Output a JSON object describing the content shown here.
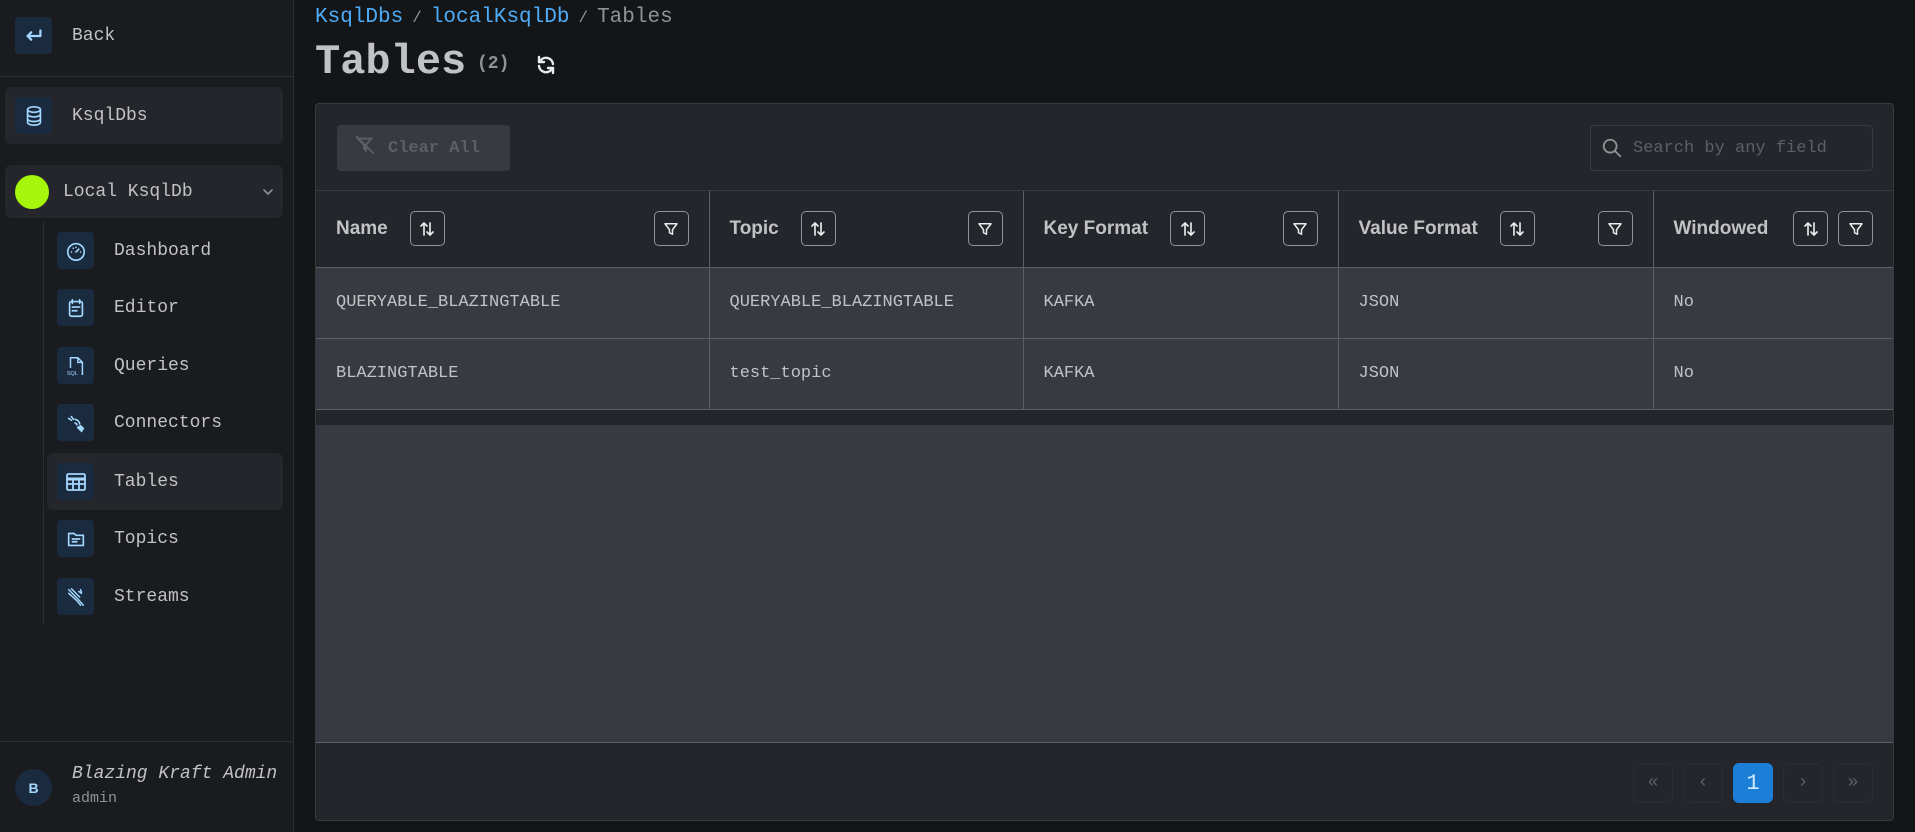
{
  "sidebar": {
    "back_label": "Back",
    "section_label": "KsqlDbs",
    "cluster": {
      "label": "Local KsqlDb",
      "status_color": "#a6f50c"
    },
    "nav": [
      {
        "label": "Dashboard",
        "icon": "gauge-icon"
      },
      {
        "label": "Editor",
        "icon": "calendar-note-icon"
      },
      {
        "label": "Queries",
        "icon": "file-sql-icon"
      },
      {
        "label": "Connectors",
        "icon": "plug-connected-icon"
      },
      {
        "label": "Tables",
        "icon": "table-icon",
        "active": true
      },
      {
        "label": "Topics",
        "icon": "folder-icon"
      },
      {
        "label": "Streams",
        "icon": "streams-icon"
      }
    ],
    "user": {
      "initial": "B",
      "name": "Blazing Kraft Admin",
      "role": "admin"
    }
  },
  "header": {
    "breadcrumb": [
      {
        "label": "KsqlDbs",
        "link": true
      },
      {
        "label": "localKsqlDb",
        "link": true
      },
      {
        "label": "Tables",
        "link": false
      }
    ],
    "title": "Tables",
    "count": "(2)"
  },
  "toolbar": {
    "clear_all_label": "Clear All",
    "search_placeholder": "Search by any field",
    "search_value": ""
  },
  "table": {
    "columns": [
      "Name",
      "Topic",
      "Key Format",
      "Value Format",
      "Windowed"
    ],
    "rows": [
      [
        "QUERYABLE_BLAZINGTABLE",
        "QUERYABLE_BLAZINGTABLE",
        "KAFKA",
        "JSON",
        "No"
      ],
      [
        "BLAZINGTABLE",
        "test_topic",
        "KAFKA",
        "JSON",
        "No"
      ]
    ]
  },
  "pagination": {
    "current_page": "1",
    "first_label": "«",
    "prev_label": "‹",
    "next_label": "›",
    "last_label": "»"
  },
  "colors": {
    "accent": "#1c7ed6",
    "link": "#4dabf7",
    "status_online": "#a6f50c"
  }
}
